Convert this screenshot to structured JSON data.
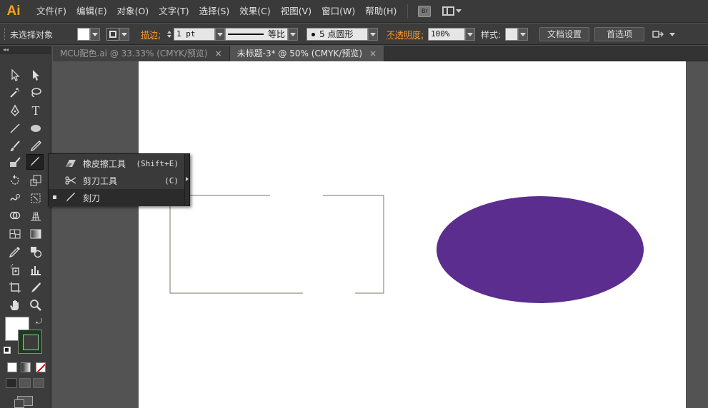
{
  "app": {
    "logo": "Ai",
    "bridge_label": "Br"
  },
  "menu": [
    "文件(F)",
    "编辑(E)",
    "对象(O)",
    "文字(T)",
    "选择(S)",
    "效果(C)",
    "视图(V)",
    "窗口(W)",
    "帮助(H)"
  ],
  "control": {
    "selection_status": "未选择对象",
    "stroke_label": "描边:",
    "stroke_weight": "1 pt",
    "stroke_profile_label": "等比",
    "brush_label": "5 点圆形",
    "opacity_label": "不透明度:",
    "opacity_value": "100%",
    "style_label": "样式:",
    "doc_setup_button": "文档设置",
    "preferences_button": "首选项"
  },
  "tabs": [
    {
      "label": "MCU配色.ai @ 33.33% (CMYK/预览)",
      "close": "×",
      "active": false
    },
    {
      "label": "未标题-3* @ 50% (CMYK/预览)",
      "close": "×",
      "active": true
    }
  ],
  "toolbox": {
    "collapse": "◂◂",
    "type_tool": "T"
  },
  "flyout": {
    "items": [
      {
        "label": "橡皮擦工具",
        "shortcut": "(Shift+E)"
      },
      {
        "label": "剪刀工具",
        "shortcut": "(C)"
      },
      {
        "label": "刻刀",
        "shortcut": ""
      }
    ]
  },
  "colors": {
    "ellipse_fill": "#5b2d8e",
    "rect_stroke": "#77775f",
    "accent_orange": "#f29a38",
    "logo": "#f7a21c"
  }
}
